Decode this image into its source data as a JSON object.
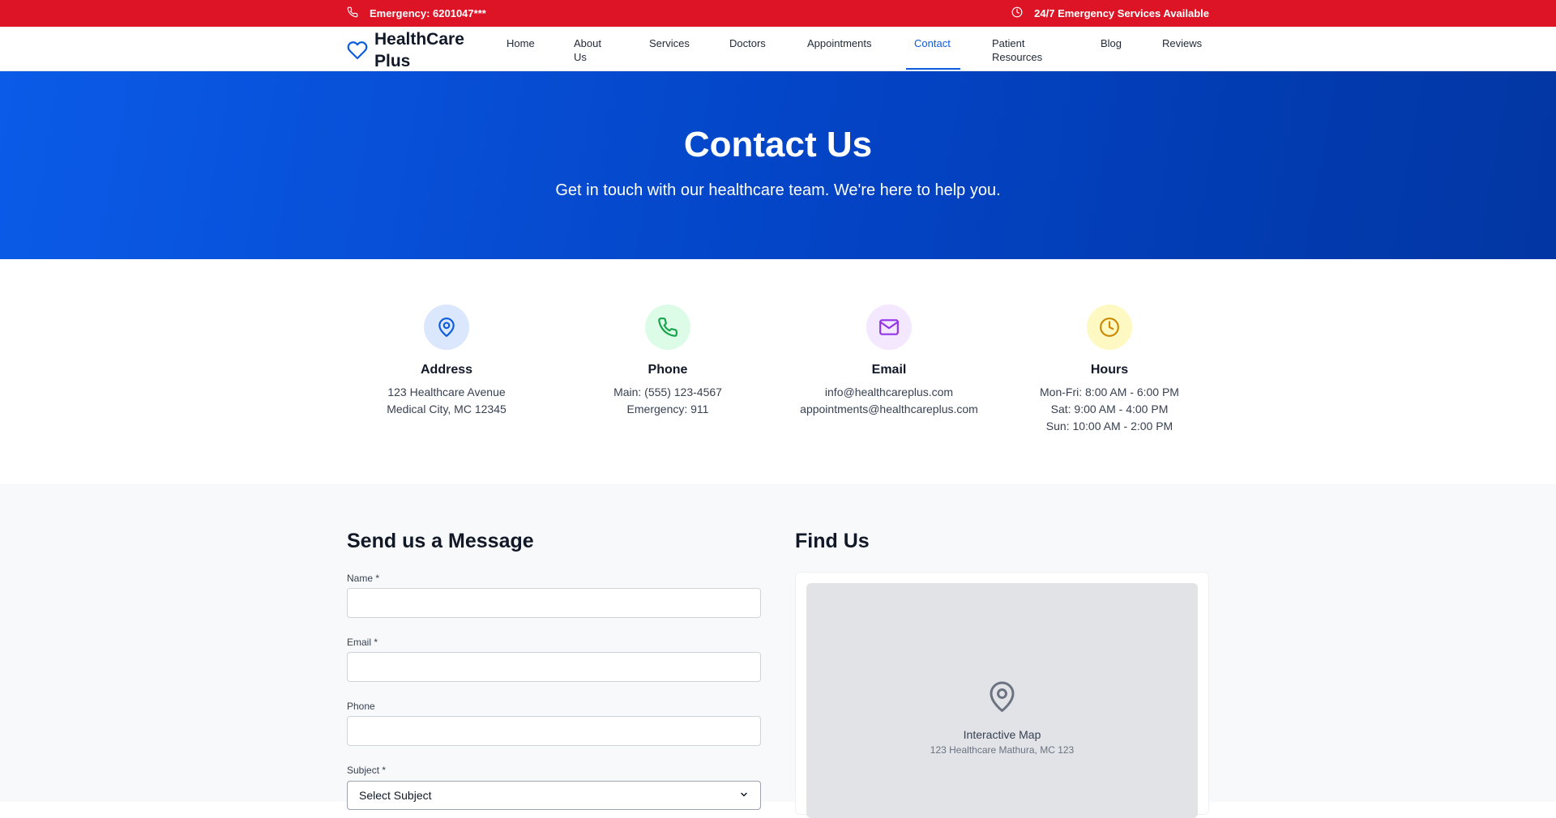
{
  "topbar": {
    "emergency": "Emergency: 6201047***",
    "availability": "24/7 Emergency Services Available"
  },
  "brand": {
    "name": "HealthCare Plus"
  },
  "nav": {
    "items": [
      "Home",
      "About Us",
      "Services",
      "Doctors",
      "Appointments",
      "Contact",
      "Patient Resources",
      "Blog",
      "Reviews"
    ],
    "active": "Contact"
  },
  "hero": {
    "title": "Contact Us",
    "subtitle": "Get in touch with our healthcare team. We're here to help you."
  },
  "info": [
    {
      "title": "Address",
      "lines": [
        "123 Healthcare Avenue",
        "Medical City, MC 12345"
      ],
      "icon": "map-pin-icon",
      "color": "#0b5bdc",
      "bg": "#dbe7fd"
    },
    {
      "title": "Phone",
      "lines": [
        "Main: (555) 123-4567",
        "Emergency: 911"
      ],
      "icon": "phone-icon",
      "color": "#16a34a",
      "bg": "#dcfce7"
    },
    {
      "title": "Email",
      "lines": [
        "info@healthcareplus.com",
        "appointments@healthcareplus.com"
      ],
      "icon": "mail-icon",
      "color": "#9333ea",
      "bg": "#f3e8ff"
    },
    {
      "title": "Hours",
      "lines": [
        "Mon-Fri: 8:00 AM - 6:00 PM",
        "Sat: 9:00 AM - 4:00 PM",
        "Sun: 10:00 AM - 2:00 PM"
      ],
      "icon": "clock-icon",
      "color": "#ca8a04",
      "bg": "#fef9c3"
    }
  ],
  "form": {
    "title": "Send us a Message",
    "name_label": "Name *",
    "email_label": "Email *",
    "phone_label": "Phone",
    "subject_label": "Subject *",
    "subject_value": "Select Subject"
  },
  "map": {
    "title": "Find Us",
    "label": "Interactive Map",
    "address": "123 Healthcare Mathura, MC 123"
  },
  "colors": {
    "topbar": "#dc1426",
    "primary": "#0b5bdc"
  }
}
